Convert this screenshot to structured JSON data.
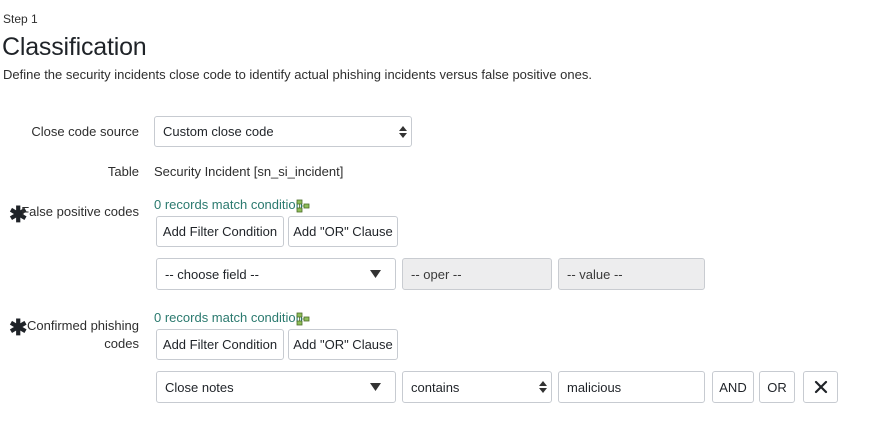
{
  "step": "Step 1",
  "title": "Classification",
  "description": "Define the security incidents close code to identify actual phishing incidents versus false positive ones.",
  "close_code_source": {
    "label": "Close code source",
    "value": "Custom close code"
  },
  "table": {
    "label": "Table",
    "value": "Security Incident [sn_si_incident]"
  },
  "false_positive": {
    "required_mark": "✱",
    "label": "False positive codes",
    "match_text": "0 records match condition",
    "add_filter": "Add Filter Condition",
    "add_or": "Add \"OR\" Clause",
    "field": "-- choose field --",
    "oper": "-- oper --",
    "value": "-- value --"
  },
  "confirmed_phishing": {
    "required_mark": "✱",
    "label_line1": "Confirmed phishing",
    "label_line2": "codes",
    "match_text": "0 records match condition",
    "add_filter": "Add Filter Condition",
    "add_or": "Add \"OR\" Clause",
    "field": "Close notes",
    "oper": "contains",
    "value": "malicious",
    "and_label": "AND",
    "or_label": "OR",
    "remove_icon": "close-icon"
  },
  "colors": {
    "link": "#2b7a6f",
    "disabled_bg": "#ededee",
    "border": "#c7cbd1"
  }
}
